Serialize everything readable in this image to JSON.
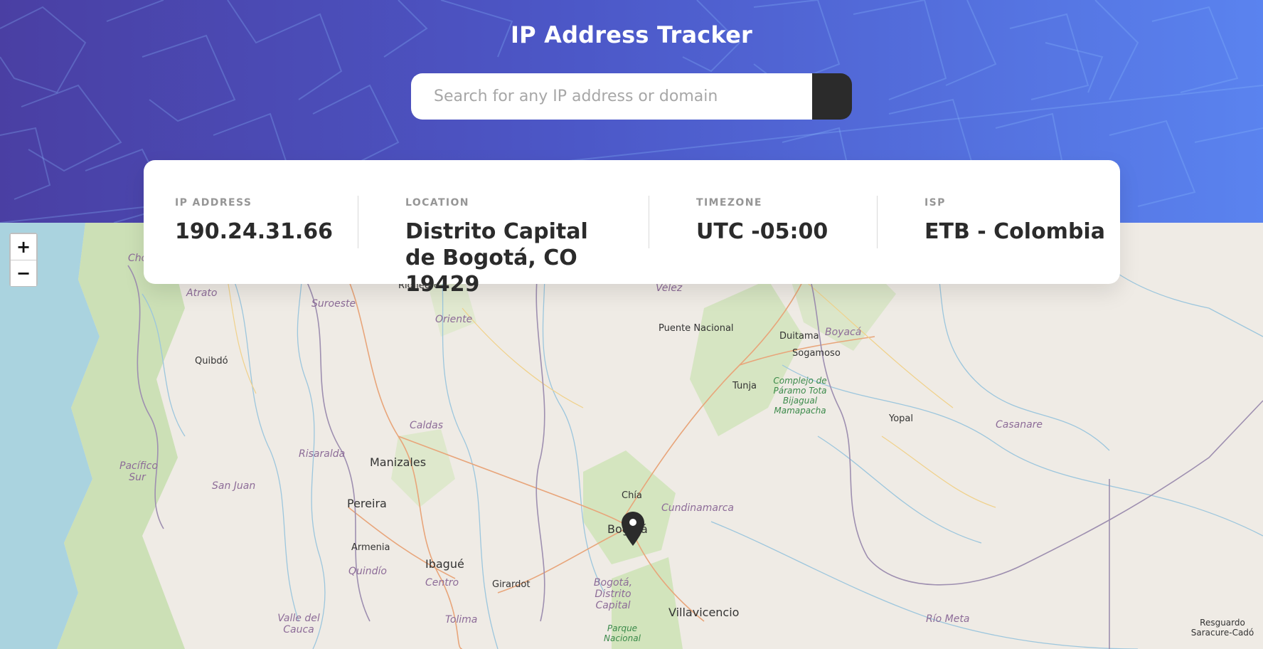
{
  "header": {
    "title": "IP Address Tracker"
  },
  "search": {
    "placeholder": "Search for any IP address or domain",
    "value": "",
    "button_icon": "chevron-right-icon"
  },
  "info": {
    "ip_label": "IP ADDRESS",
    "ip_value": "190.24.31.66",
    "location_label": "LOCATION",
    "location_value": "Distrito Capital de Bogotá, CO 19429",
    "timezone_label": "TIMEZONE",
    "timezone_value": "UTC -05:00",
    "isp_label": "ISP",
    "isp_value": "ETB - Colombia"
  },
  "map": {
    "zoom_in": "+",
    "zoom_out": "−",
    "marker_icon": "map-pin-icon",
    "labels": {
      "rionegro": "Rionegro",
      "velez": "Vélez",
      "atrato": "Atrato",
      "suroeste": "Suroeste",
      "oriente": "Oriente",
      "puente_nacional": "Puente Nacional",
      "duitama": "Duitama",
      "boyaca": "Boyacá",
      "sogamoso": "Sogamoso",
      "quibdo": "Quibdó",
      "tunja": "Tunja",
      "complejo": "Complejo de Páramo Tota Bijagual Mamapacha",
      "yopal": "Yopal",
      "casanare": "Casanare",
      "caldas": "Caldas",
      "risaralda": "Risaralda",
      "manizales": "Manizales",
      "pacifico_sur": "Pacífico Sur",
      "san_juan": "San Juan",
      "pereira": "Pereira",
      "chia": "Chía",
      "cundinamarca": "Cundinamarca",
      "bogota": "Bogotá",
      "armenia": "Armenia",
      "ibague": "Ibagué",
      "quindio": "Quindío",
      "centro": "Centro",
      "girardot": "Girardot",
      "bogota_dc": "Bogotá, Distrito Capital",
      "villavicencio": "Villavicencio",
      "valle_del_cauca": "Valle del Cauca",
      "tolima": "Tolima",
      "parque_nacional": "Parque Nacional",
      "rio_meta": "Río Meta",
      "resguardo": "Resguardo Saracure-Cadó",
      "cho": "Cho"
    }
  },
  "colors": {
    "header_start": "#4a3fa3",
    "header_end": "#5a83ef",
    "text_dark": "#2b2b2b",
    "label_gray": "#969696",
    "map_land": "#efebe5",
    "map_sea": "#aad3df",
    "forest": "#c8dfb0"
  }
}
